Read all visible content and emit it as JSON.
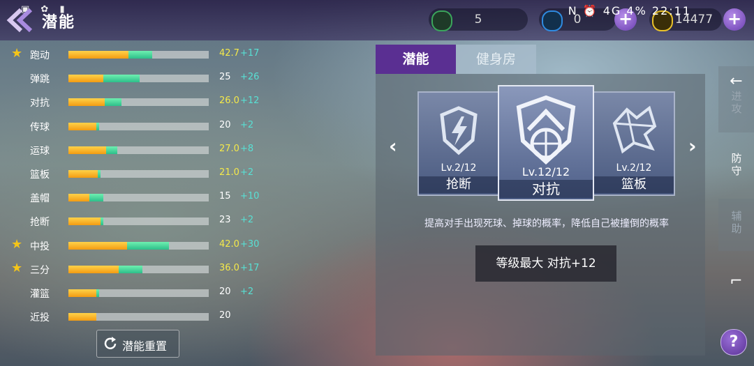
{
  "header": {
    "title": "潜能",
    "status_text": "N ⏰ 4G 4% 22:11"
  },
  "currencies": [
    {
      "name": "energy",
      "value": "5",
      "icon": "battery-icon",
      "color": "#3ba55c"
    },
    {
      "name": "diamond",
      "value": "0",
      "icon": "diamond-icon",
      "color": "#2f8be0"
    },
    {
      "name": "coin",
      "value": "14477",
      "icon": "coin-icon",
      "color": "#e8c12a"
    }
  ],
  "stats": [
    {
      "label": "跑动",
      "starred": true,
      "value": "42.7",
      "bonus": "+17",
      "base_fraction": 0.43,
      "bonus_fraction": 0.17,
      "highlight": true
    },
    {
      "label": "弹跳",
      "starred": false,
      "value": "25",
      "bonus": "+26",
      "base_fraction": 0.25,
      "bonus_fraction": 0.26,
      "highlight": false
    },
    {
      "label": "对抗",
      "starred": false,
      "value": "26.0",
      "bonus": "+12",
      "base_fraction": 0.26,
      "bonus_fraction": 0.12,
      "highlight": true
    },
    {
      "label": "传球",
      "starred": false,
      "value": "20",
      "bonus": "+2",
      "base_fraction": 0.2,
      "bonus_fraction": 0.02,
      "highlight": false
    },
    {
      "label": "运球",
      "starred": false,
      "value": "27.0",
      "bonus": "+8",
      "base_fraction": 0.27,
      "bonus_fraction": 0.08,
      "highlight": true
    },
    {
      "label": "篮板",
      "starred": false,
      "value": "21.0",
      "bonus": "+2",
      "base_fraction": 0.21,
      "bonus_fraction": 0.02,
      "highlight": true
    },
    {
      "label": "盖帽",
      "starred": false,
      "value": "15",
      "bonus": "+10",
      "base_fraction": 0.15,
      "bonus_fraction": 0.1,
      "highlight": false
    },
    {
      "label": "抢断",
      "starred": false,
      "value": "23",
      "bonus": "+2",
      "base_fraction": 0.23,
      "bonus_fraction": 0.02,
      "highlight": false
    },
    {
      "label": "中投",
      "starred": true,
      "value": "42.0",
      "bonus": "+30",
      "base_fraction": 0.42,
      "bonus_fraction": 0.3,
      "highlight": true
    },
    {
      "label": "三分",
      "starred": true,
      "value": "36.0",
      "bonus": "+17",
      "base_fraction": 0.36,
      "bonus_fraction": 0.17,
      "highlight": true
    },
    {
      "label": "灌篮",
      "starred": false,
      "value": "20",
      "bonus": "+2",
      "base_fraction": 0.2,
      "bonus_fraction": 0.02,
      "highlight": false
    },
    {
      "label": "近投",
      "starred": false,
      "value": "20",
      "bonus": "",
      "base_fraction": 0.2,
      "bonus_fraction": 0.0,
      "highlight": false
    }
  ],
  "reset_button": {
    "label": "潜能重置",
    "icon": "refresh-icon"
  },
  "tabs": [
    {
      "label": "潜能",
      "active": true
    },
    {
      "label": "健身房",
      "active": false
    }
  ],
  "cards": [
    {
      "name": "抢断",
      "level": "Lv.2/12",
      "icon": "lightning-shield-icon"
    },
    {
      "name": "对抗",
      "level": "Lv.12/12",
      "icon": "basketball-shield-icon"
    },
    {
      "name": "篮板",
      "level": "Lv.2/12",
      "icon": "shattered-ball-icon"
    }
  ],
  "description": "提高对手出现死球、掉球的概率，降低自己被撞倒的概率",
  "max_box": {
    "label": "等级最大 对抗+12"
  },
  "side_tabs": [
    {
      "label": "进攻",
      "active": false
    },
    {
      "label": "防守",
      "active": true
    },
    {
      "label": "辅助",
      "active": false
    }
  ],
  "colors": {
    "accent": "#5a2f92",
    "bar_base": "#f39c12",
    "bar_bonus": "#2dbf8a",
    "bonus_text": "#58e0d4",
    "highlight_value": "#f4e94a"
  }
}
